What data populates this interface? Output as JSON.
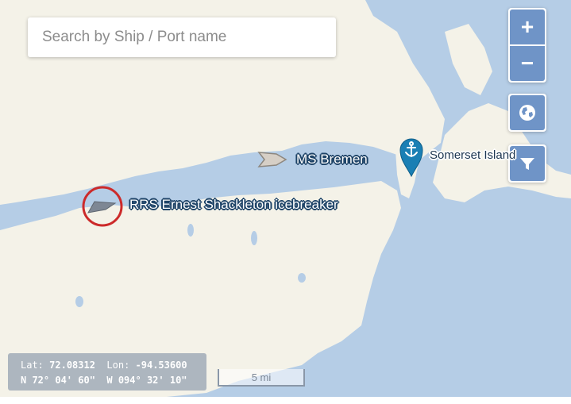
{
  "search": {
    "placeholder": "Search by Ship / Port name"
  },
  "controls": {
    "zoom_in": "+",
    "zoom_out": "−",
    "layers_icon": "globe-icon",
    "filter_icon": "filter-icon"
  },
  "ships": [
    {
      "name": "RRS Ernest Shackleton icebreaker",
      "selected": true
    },
    {
      "name": "MS Bremen",
      "selected": false
    }
  ],
  "ports": [
    {
      "name": "Somerset Island",
      "icon": "anchor-icon"
    }
  ],
  "coordinates": {
    "lat_label": "Lat:",
    "lat_value": "72.08312",
    "lon_label": "Lon:",
    "lon_value": "-94.53600",
    "lat_dms": "N 72° 04' 60\"",
    "lon_dms": "W 094° 32' 10\""
  },
  "scale": {
    "label": "5 mi"
  },
  "colors": {
    "water": "#b5cde6",
    "land": "#f4f2e8",
    "control": "#6f94c7",
    "port_marker": "#1a7fb4",
    "selection_ring": "#cc2a2a"
  }
}
